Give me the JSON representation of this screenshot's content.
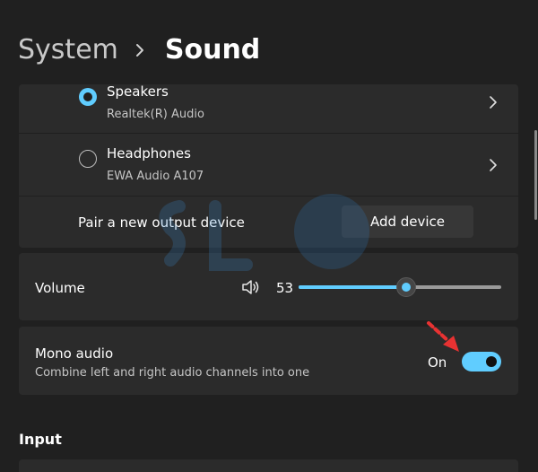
{
  "breadcrumb": {
    "parent": "System",
    "current": "Sound"
  },
  "output_devices": [
    {
      "name": "Speakers",
      "detail": "Realtek(R) Audio",
      "selected": true
    },
    {
      "name": "Headphones",
      "detail": "EWA Audio A107",
      "selected": false
    }
  ],
  "pair": {
    "label": "Pair a new output device",
    "button": "Add device"
  },
  "volume": {
    "label": "Volume",
    "value": "53",
    "level": 53
  },
  "mono_audio": {
    "title": "Mono audio",
    "description": "Combine left and right audio channels into one",
    "state": "On",
    "enabled": true
  },
  "input_section": {
    "heading": "Input"
  },
  "colors": {
    "accent": "#60cdff",
    "background": "#202020",
    "card": "#2b2b2b",
    "annotation_arrow": "#e83232"
  },
  "icons": [
    "chevron-right-icon",
    "speaker-icon",
    "radio-selected-icon",
    "radio-unselected-icon",
    "annotation-arrow-icon"
  ]
}
